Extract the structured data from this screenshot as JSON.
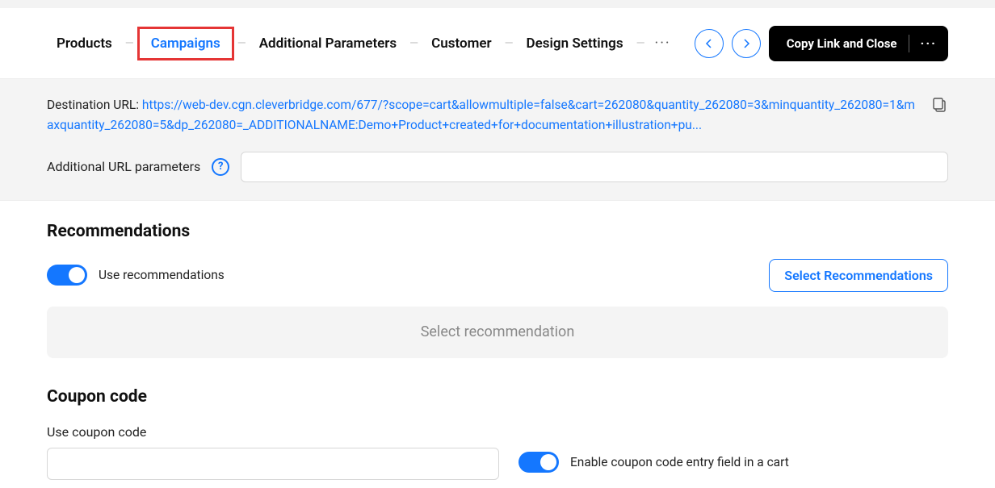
{
  "tabs": {
    "items": [
      {
        "label": "Products"
      },
      {
        "label": "Campaigns",
        "active": true
      },
      {
        "label": "Additional Parameters"
      },
      {
        "label": "Customer"
      },
      {
        "label": "Design Settings"
      }
    ]
  },
  "actions": {
    "copy_close": "Copy Link and Close"
  },
  "destination": {
    "label": "Destination URL:",
    "url": "https://web-dev.cgn.cleverbridge.com/677/?scope=cart&allowmultiple=false&cart=262080&quantity_262080=3&minquantity_262080=1&maxquantity_262080=5&dp_262080=_ADDITIONALNAME:Demo+Product+created+for+documentation+illustration+pu..."
  },
  "additional_params": {
    "label": "Additional URL parameters",
    "value": ""
  },
  "recommendations": {
    "title": "Recommendations",
    "toggle_label": "Use recommendations",
    "toggle_on": true,
    "select_button": "Select Recommendations",
    "placeholder": "Select recommendation"
  },
  "coupon": {
    "title": "Coupon code",
    "use_label": "Use coupon code",
    "input_value": "",
    "enable_label": "Enable coupon code entry field in a cart",
    "enable_on": true
  }
}
